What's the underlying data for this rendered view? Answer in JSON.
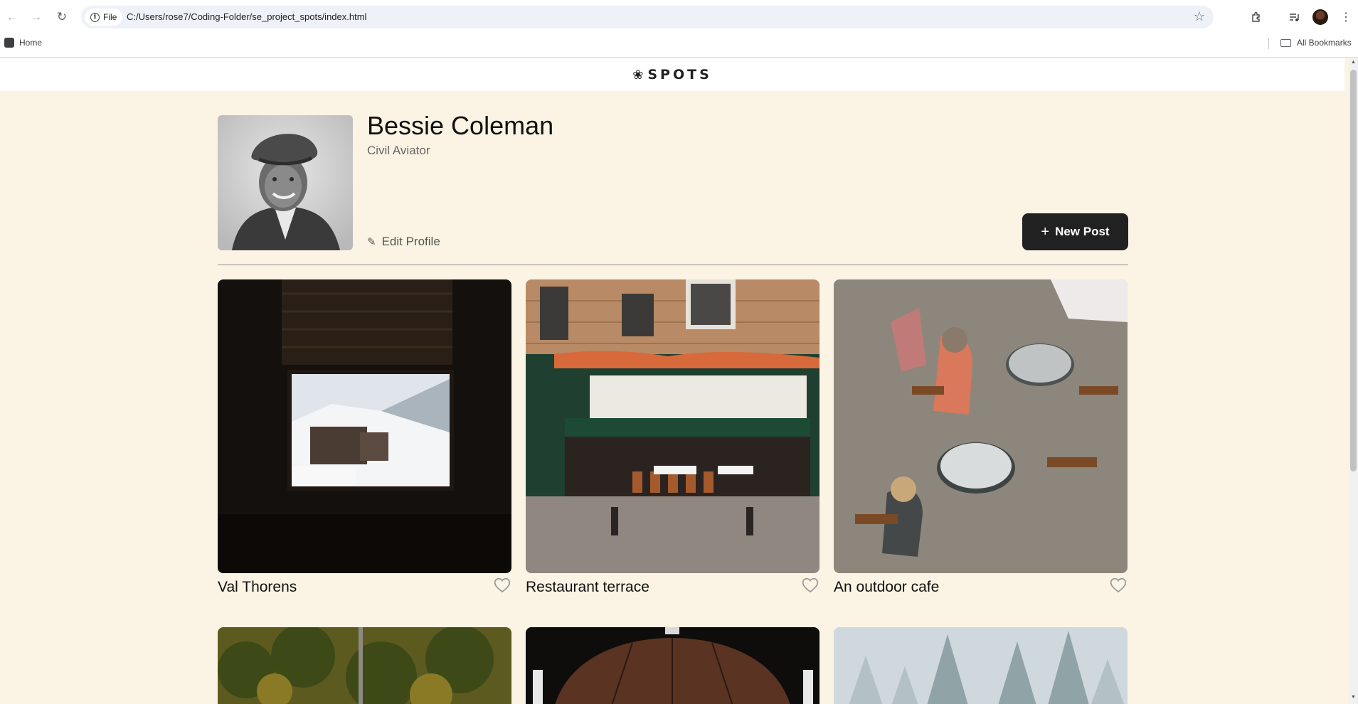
{
  "browser": {
    "site_chip": "File",
    "url": "C:/Users/rose7/Coding-Folder/se_project_spots/index.html",
    "bookmarks": {
      "home": "Home",
      "all": "All Bookmarks"
    }
  },
  "header": {
    "logo_text": "SPOTS"
  },
  "profile": {
    "name": "Bessie Coleman",
    "role": "Civil Aviator",
    "edit_label": "Edit Profile",
    "new_post_label": "New Post"
  },
  "cards": [
    {
      "title": "Val Thorens"
    },
    {
      "title": "Restaurant terrace"
    },
    {
      "title": "An outdoor cafe"
    }
  ],
  "colors": {
    "page_bg": "#fbf3e3",
    "button_bg": "#212121",
    "text": "#212121"
  }
}
